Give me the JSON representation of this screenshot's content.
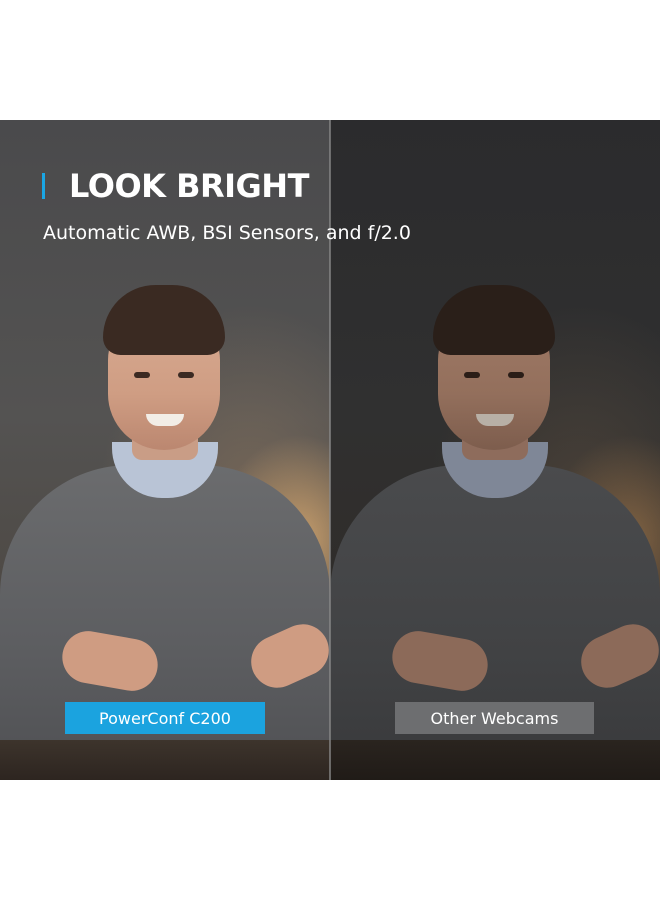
{
  "headline": {
    "title": "LOOK BRIGHT",
    "subtitle": "Automatic AWB, BSI Sensors, and f/2.0"
  },
  "comparison": {
    "left_label": "PowerConf C200",
    "right_label": "Other Webcams"
  },
  "colors": {
    "accent": "#1ba3df",
    "secondary_label_bg": "#6d6e70",
    "text": "#ffffff"
  }
}
